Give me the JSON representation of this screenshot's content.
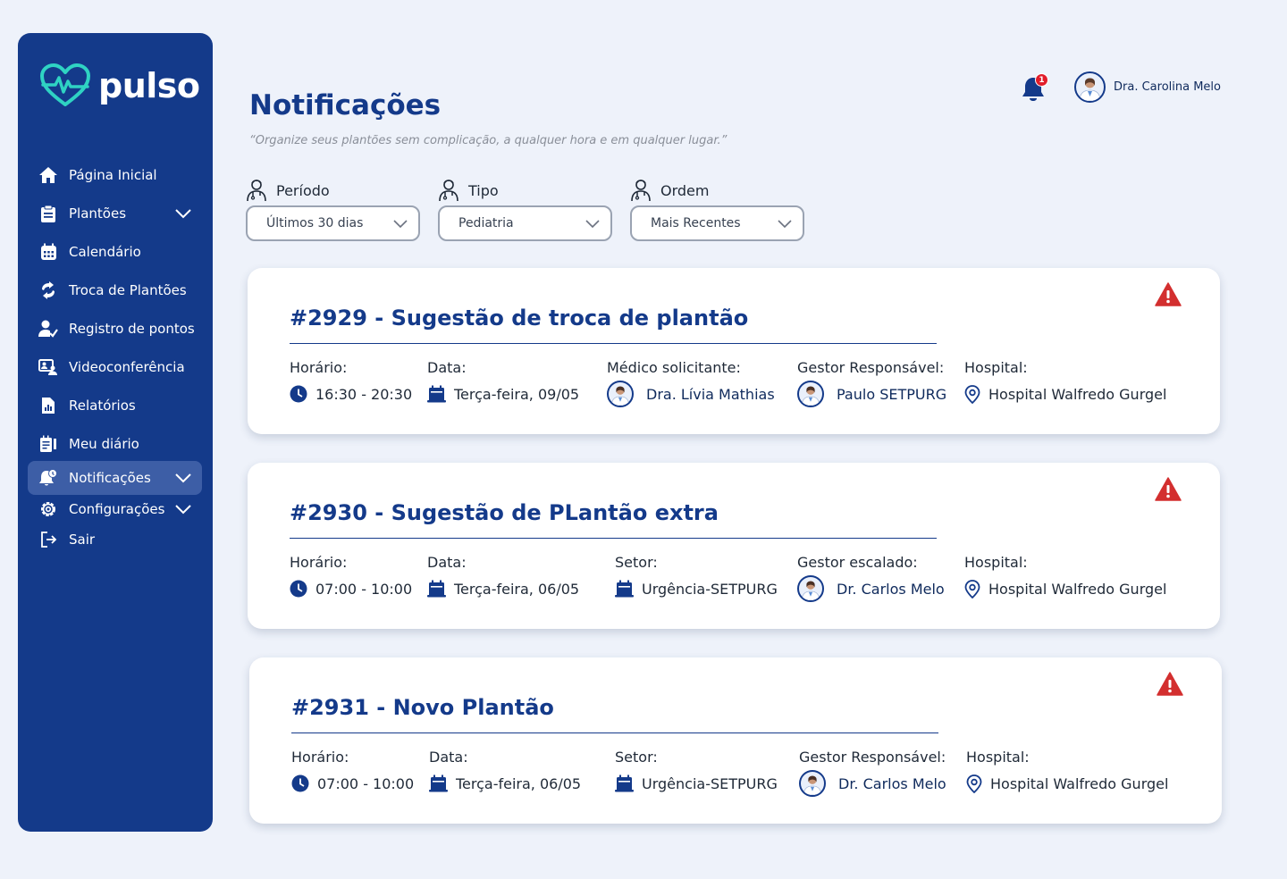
{
  "brand": {
    "name": "pulso",
    "accent": "#2fd3c3",
    "primary": "#143a8a",
    "alert": "#d32f2f"
  },
  "sidebar": {
    "items": [
      {
        "label": "Página Inicial",
        "icon": "home-icon"
      },
      {
        "label": "Plantões",
        "icon": "clipboard-icon",
        "expandable": true
      },
      {
        "label": "Calendário",
        "icon": "calendar-icon"
      },
      {
        "label": "Troca de Plantões",
        "icon": "swap-icon"
      },
      {
        "label": "Registro de pontos",
        "icon": "user-check-icon"
      },
      {
        "label": "Videoconferência",
        "icon": "video-call-icon"
      },
      {
        "label": "Relatórios",
        "icon": "report-icon"
      },
      {
        "label": "Meu diário",
        "icon": "diary-icon"
      },
      {
        "label": "Notificações",
        "icon": "bell-icon",
        "expandable": true,
        "active": true
      },
      {
        "label": "Configurações",
        "icon": "gear-icon",
        "expandable": true
      },
      {
        "label": "Sair",
        "icon": "logout-icon"
      }
    ]
  },
  "header": {
    "notification_count": "1",
    "user_name": "Dra. Carolina Melo"
  },
  "page": {
    "title": "Notificações",
    "subtitle": "“Organize seus plantões sem complicação, a qualquer hora e em qualquer lugar.”"
  },
  "filters": [
    {
      "label": "Período",
      "value": "Últimos 30 dias"
    },
    {
      "label": "Tipo",
      "value": "Pediatria"
    },
    {
      "label": "Ordem",
      "value": "Mais Recentes"
    }
  ],
  "cards": [
    {
      "title": "#2929 - Sugestão de troca de plantão",
      "fields": [
        {
          "label": "Horário:",
          "value": "16:30 - 20:30",
          "icon": "clock-icon"
        },
        {
          "label": "Data:",
          "value": "Terça-feira, 09/05",
          "icon": "calendar-icon"
        },
        {
          "label": "Médico solicitante:",
          "value": "Dra. Lívia Mathias",
          "icon": "doctor-avatar"
        },
        {
          "label": "Gestor Responsável:",
          "value": "Paulo SETPURG",
          "icon": "doctor-avatar"
        },
        {
          "label": "Hospital:",
          "value": "Hospital Walfredo Gurgel",
          "icon": "location-pin-icon"
        }
      ]
    },
    {
      "title": "#2930 - Sugestão de PLantão extra",
      "fields": [
        {
          "label": "Horário:",
          "value": "07:00 - 10:00",
          "icon": "clock-icon"
        },
        {
          "label": "Data:",
          "value": "Terça-feira, 06/05",
          "icon": "calendar-icon"
        },
        {
          "label": "Setor:",
          "value": "Urgência-SETPURG",
          "icon": "calendar-icon"
        },
        {
          "label": "Gestor escalado:",
          "value": "Dr. Carlos Melo",
          "icon": "doctor-avatar"
        },
        {
          "label": "Hospital:",
          "value": "Hospital Walfredo Gurgel",
          "icon": "location-pin-icon"
        }
      ]
    },
    {
      "title": "#2931 - Novo Plantão",
      "fields": [
        {
          "label": "Horário:",
          "value": "07:00 - 10:00",
          "icon": "clock-icon"
        },
        {
          "label": "Data:",
          "value": "Terça-feira, 06/05",
          "icon": "calendar-icon"
        },
        {
          "label": "Setor:",
          "value": "Urgência-SETPURG",
          "icon": "calendar-icon"
        },
        {
          "label": "Gestor Responsável:",
          "value": "Dr. Carlos Melo",
          "icon": "doctor-avatar"
        },
        {
          "label": "Hospital:",
          "value": "Hospital Walfredo Gurgel",
          "icon": "location-pin-icon"
        }
      ]
    }
  ]
}
